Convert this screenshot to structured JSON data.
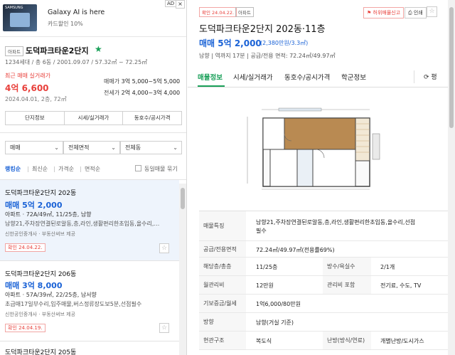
{
  "ad": {
    "brand": "SAMSUNG",
    "title": "Galaxy AI is here",
    "subtitle": "카드할인 10%",
    "badge": "AD",
    "close": "×"
  },
  "complex": {
    "type_badge": "아파트",
    "name": "도덕파크타운2단지",
    "info": "1234세대 / 총 6동 / 2001.09.07 / 57.32㎡ ~ 72.25㎡",
    "recent_label": "최근 매매 실거래가",
    "recent_price": "4억 6,600",
    "recent_date": "2024.04.01, 2층, 72㎡",
    "sale_label": "매매가",
    "sale_range": "3억 5,000~5억 5,000",
    "jeonse_label": "전세가",
    "jeonse_range": "2억 4,000~3억 4,000"
  },
  "complex_tabs": [
    "단지정보",
    "시세/실거래가",
    "동호수/공시가격"
  ],
  "filters": {
    "trade": "매매",
    "area": "전체면적",
    "dong": "전체동"
  },
  "sort": {
    "items": [
      "랭킹순",
      "최신순",
      "가격순",
      "면적순"
    ],
    "same_listing": "동일매물 묶기"
  },
  "listings": [
    {
      "title": "도덕파크타운2단지 202동",
      "price": "매매 5억 2,000",
      "spec": "아파트 · 72A/49㎡, 11/25층, 남향",
      "desc": "남향21,주차장연결된로알동,층,라인,생활편리한초입동,올수리,…",
      "agent": "신한공인중개사 · 부동산써브 제공",
      "date": "확인 24.04.22."
    },
    {
      "title": "도덕파크타운2단지 206동",
      "price": "매매 3억 8,000",
      "spec": "아파트 · 57A/39㎡, 22/25층, 남서향",
      "desc": "초급매17일부수리,입주매물,버스정류장도보5분,선점필수",
      "agent": "신한공인중개사 · 부동산써브 제공",
      "date": "확인 24.04.19."
    },
    {
      "title": "도덕파크타운2단지 205동"
    }
  ],
  "detail": {
    "date_badge": "확인 24.04.22.",
    "type_badge": "아파트",
    "report": "허위매물신고",
    "print": "인쇄",
    "title": "도덕파크타운2단지 202동·11층",
    "price": "매매 5억 2,000",
    "unit_price": "(2,380만원/3.3㎡)",
    "meta": "남향  |  역까지 17분  |  공급/전용 면적: 72.24㎡/49.97㎡",
    "tabs": [
      "매물정보",
      "시세/실거래가",
      "동호수/공시가격",
      "학군정보"
    ],
    "refresh": "평"
  },
  "info_rows": [
    {
      "k": "매물특징",
      "v": "남향21,주차장연결된로알동,층,라인,생활편리한초입동,올수리,선점",
      "v_line2": "필수"
    },
    {
      "k": "공급/전용면적",
      "v": "72.24㎡/49.97㎡(전용률69%)"
    },
    {
      "k": "해당층/총층",
      "v": "11/25층",
      "k2": "방수/욕실수",
      "v2": "2/1개"
    },
    {
      "k": "월관리비",
      "v": "12만원",
      "k2": "관리비 포함",
      "v2": "전기료, 수도, TV"
    },
    {
      "k": "기보증금/월세",
      "v": "1억6,000/80만원"
    },
    {
      "k": "방향",
      "v": "남향(거실 기준)"
    },
    {
      "k": "현관구조",
      "v": "복도식",
      "k2": "난방(방식/연료)",
      "v2": "개별난방/도시가스"
    }
  ]
}
